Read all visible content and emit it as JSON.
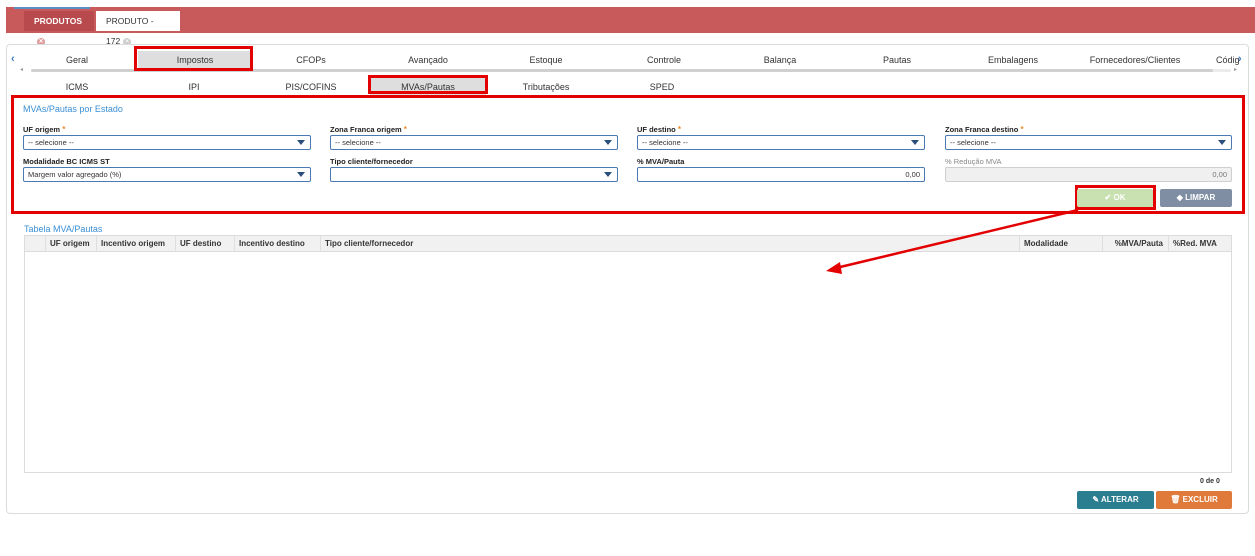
{
  "top_tabs": [
    {
      "label": "PRODUTOS"
    },
    {
      "label": "PRODUTO - 172"
    }
  ],
  "main_tabs": [
    "Geral",
    "Impostos",
    "CFOPs",
    "Avançado",
    "Estoque",
    "Controle",
    "Balança",
    "Pautas",
    "Embalagens",
    "Fornecedores/Clientes",
    "Códig"
  ],
  "sub_tabs": [
    "ICMS",
    "IPI",
    "PIS/COFINS",
    "MVAs/Pautas",
    "Tributações",
    "SPED"
  ],
  "form": {
    "title": "MVAs/Pautas por Estado",
    "uf_origem": {
      "label": "UF origem",
      "value": "-- selecione --"
    },
    "zona_franca_origem": {
      "label": "Zona Franca origem",
      "value": "-- selecione --"
    },
    "uf_destino": {
      "label": "UF destino",
      "value": "-- selecione --"
    },
    "zona_franca_destino": {
      "label": "Zona Franca destino",
      "value": "-- selecione --"
    },
    "modalidade": {
      "label": "Modalidade BC ICMS ST",
      "value": "Margem valor agregado (%)"
    },
    "tipo_cliente": {
      "label": "Tipo cliente/fornecedor",
      "value": ""
    },
    "mva_pauta": {
      "label": "% MVA/Pauta",
      "value": "0,00"
    },
    "reducao_mva": {
      "label": "% Redução MVA",
      "value": "0,00"
    },
    "required_mark": "*"
  },
  "buttons": {
    "ok": "OK",
    "limpar": "LIMPAR",
    "alterar": "ALTERAR",
    "excluir": "EXCLUIR"
  },
  "table": {
    "title": "Tabela MVA/Pautas",
    "columns": [
      "UF origem",
      "Incentivo origem",
      "UF destino",
      "Incentivo destino",
      "Tipo cliente/fornecedor",
      "Modalidade",
      "%MVA/Pauta",
      "%Red. MVA"
    ],
    "count": "0 de 0"
  },
  "colors": {
    "accent": "#c95a5c",
    "highlight": "#e30000",
    "link": "#3a8fd4"
  }
}
